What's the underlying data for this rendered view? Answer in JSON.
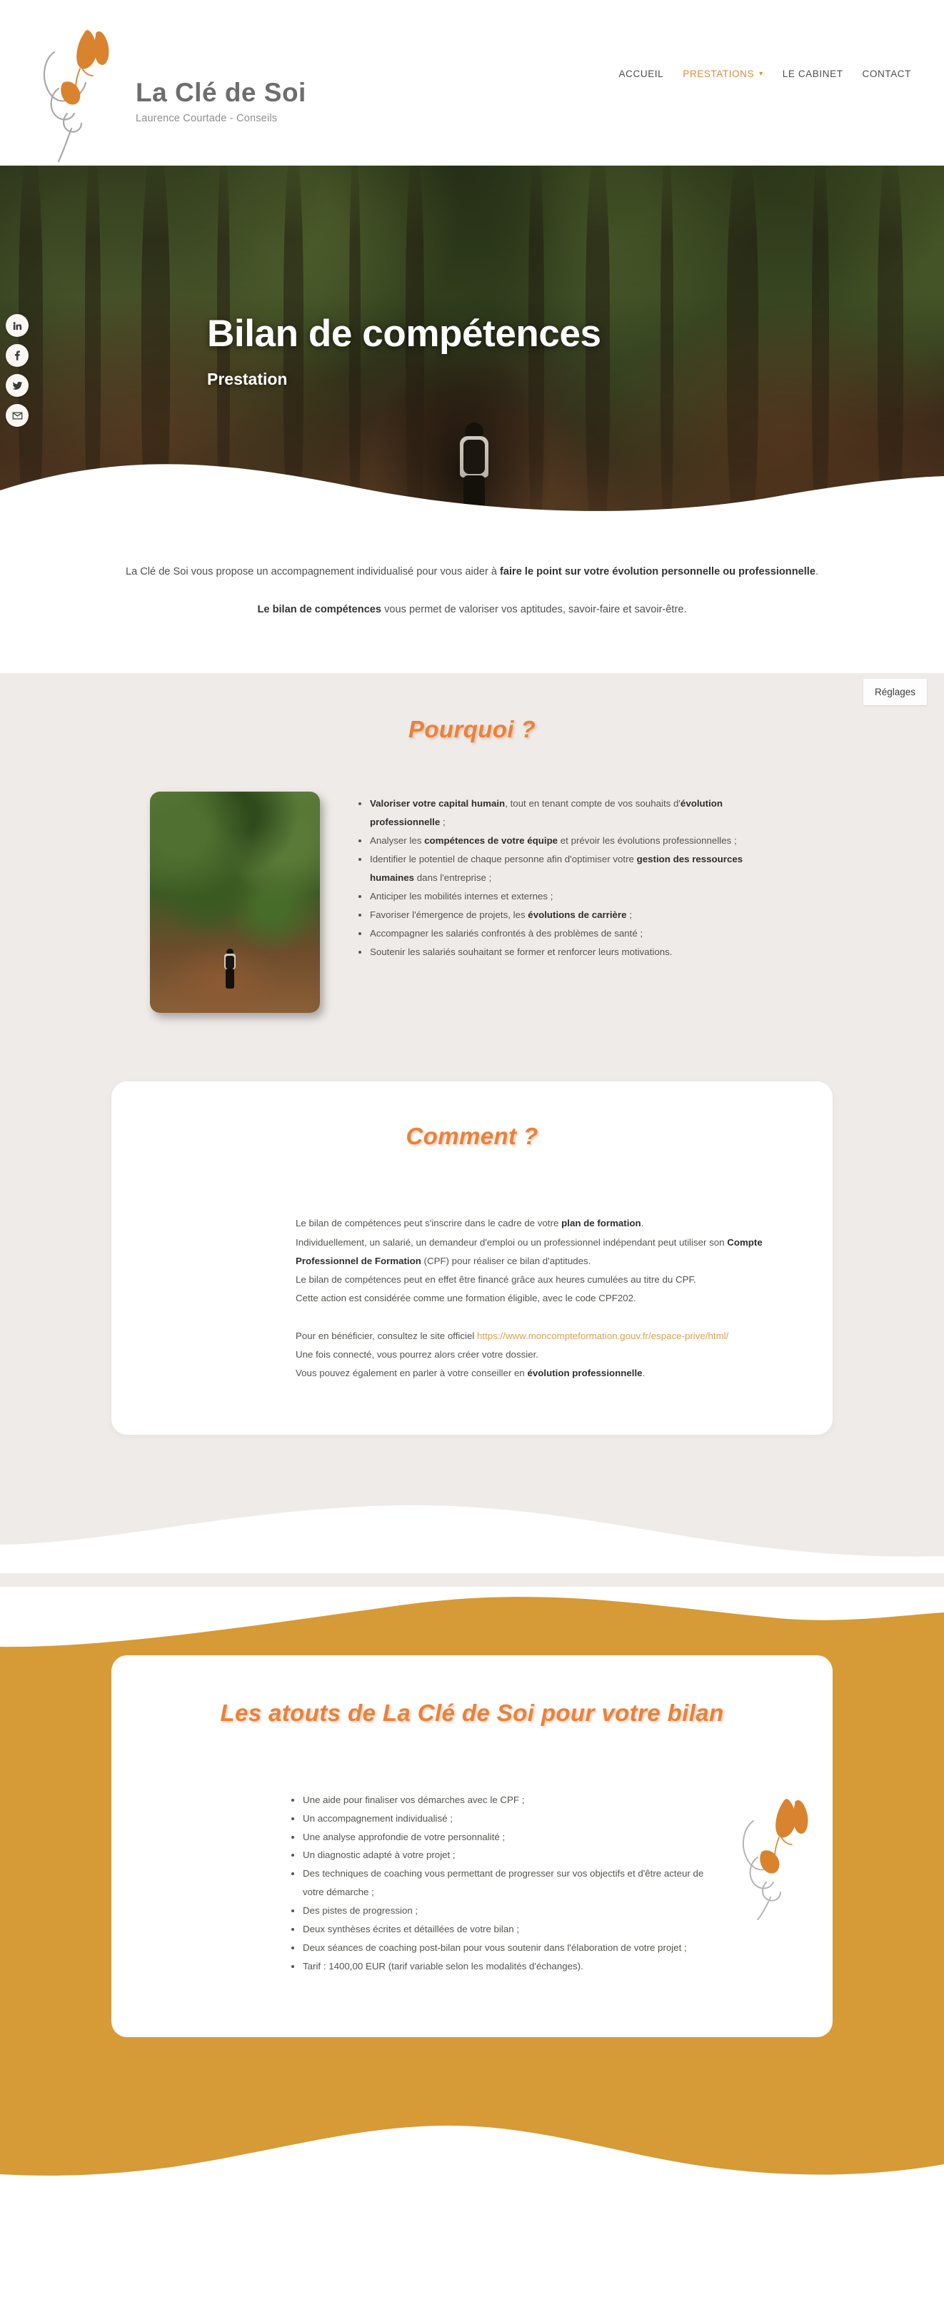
{
  "header": {
    "brand_title": "La Clé de Soi",
    "brand_subtitle": "Laurence Courtade - Conseils",
    "logo_icon": "butterfly-logo-icon",
    "nav": [
      {
        "label": "ACCUEIL",
        "active": false,
        "has_caret": false
      },
      {
        "label": "PRESTATIONS",
        "active": true,
        "has_caret": true,
        "caret_icon": "chevron-down-icon"
      },
      {
        "label": "LE CABINET",
        "active": false,
        "has_caret": false
      },
      {
        "label": "CONTACT",
        "active": false,
        "has_caret": false
      }
    ]
  },
  "social_rail": [
    {
      "icon": "linkedin-icon",
      "label": "in"
    },
    {
      "icon": "facebook-icon",
      "label": "f"
    },
    {
      "icon": "twitter-icon",
      "label": "twitter"
    },
    {
      "icon": "email-icon",
      "label": "mail"
    }
  ],
  "hero": {
    "title": "Bilan de compétences",
    "subtitle": "Prestation",
    "background_image": "forest-path-hiker-photo"
  },
  "intro": {
    "paragraph1_lead": "La Clé de Soi vous propose un accompagnement individualisé pour vous aider à ",
    "paragraph1_bold": "faire le point sur votre évolution personnelle ou professionnelle",
    "paragraph1_tail": ".",
    "paragraph2_bold": "Le bilan de compétences",
    "paragraph2_tail": " vous permet de valoriser vos aptitudes, savoir-faire et savoir-être."
  },
  "settings_button": {
    "label": "Réglages"
  },
  "pourquoi": {
    "heading": "Pourquoi ?",
    "image": "forest-path-hiker-thumbnail",
    "bullets": [
      {
        "bold_lead": "Valoriser votre capital humain",
        "text_mid": ", tout en tenant compte de vos souhaits d'",
        "bold_tail": "évolution professionnelle",
        "text_end": " ;"
      },
      {
        "bold_lead": "",
        "text_mid": "Analyser les ",
        "bold_tail": "compétences de votre équipe",
        "text_end": " et prévoir les évolutions professionnelles ;"
      },
      {
        "bold_lead": "",
        "text_mid": "Identifier le potentiel de chaque personne afin d'optimiser votre ",
        "bold_tail": "gestion des ressources humaines",
        "text_end": " dans l'entreprise ;"
      },
      {
        "bold_lead": "",
        "text_mid": "Anticiper les mobilités internes et externes ;",
        "bold_tail": "",
        "text_end": ""
      },
      {
        "bold_lead": "",
        "text_mid": "Favoriser l'émergence de projets, les ",
        "bold_tail": "évolutions de carrière",
        "text_end": " ;"
      },
      {
        "bold_lead": "",
        "text_mid": "Accompagner les salariés confrontés à des problèmes de santé ;",
        "bold_tail": "",
        "text_end": ""
      },
      {
        "bold_lead": "",
        "text_mid": "Soutenir les salariés souhaitant se former et renforcer leurs motivations.",
        "bold_tail": "",
        "text_end": ""
      }
    ]
  },
  "comment": {
    "heading": "Comment ?",
    "line1_pre": "Le bilan de compétences peut s'inscrire dans le cadre de votre ",
    "line1_bold": "plan de formation",
    "line1_post": ".",
    "line2": "Individuellement, un salarié, un demandeur d'emploi ou un professionnel indépendant peut utiliser son ",
    "line2_bold": "Compte Professionnel de Formation",
    "line2_post": " (CPF) pour réaliser ce bilan d'aptitudes.",
    "line3": "Le bilan de compétences peut en effet être financé grâce aux heures cumulées au titre du CPF.",
    "line4": "Cette action est considérée comme une formation éligible, avec le code CPF202.",
    "line5_pre": "Pour en bénéficier, consultez le site officiel ",
    "line5_link": "https://www.moncompteformation.gouv.fr/espace-prive/html/",
    "line6": "Une fois connecté, vous pourrez alors créer votre dossier.",
    "line7_pre": "Vous pouvez également en parler à votre conseiller en ",
    "line7_bold": "évolution professionnelle",
    "line7_post": "."
  },
  "atouts": {
    "heading": "Les atouts de La Clé de Soi pour votre bilan",
    "decoration_icon": "butterfly-logo-icon",
    "bullets": [
      "Une aide pour finaliser vos démarches avec le CPF ;",
      "Un accompagnement individualisé ;",
      "Une analyse approfondie de votre personnalité ;",
      "Un diagnostic adapté à votre projet ;",
      "Des techniques de coaching vous permettant de progresser sur vos objectifs et d'être acteur de votre démarche ;",
      "Des pistes de progression ;",
      "Deux synthèses écrites et détaillées de votre bilan ;",
      "Deux séances de coaching post-bilan pour vous soutenir dans l'élaboration de votre projet ;",
      "Tarif : 1400,00 EUR (tarif variable selon les modalités d'échanges)."
    ]
  },
  "colors": {
    "accent_orange": "#e8823c",
    "brand_gold": "#d69a36",
    "grey_bg": "#efebe9",
    "link": "#d9a055",
    "brand_grey": "#6d6d6d"
  }
}
